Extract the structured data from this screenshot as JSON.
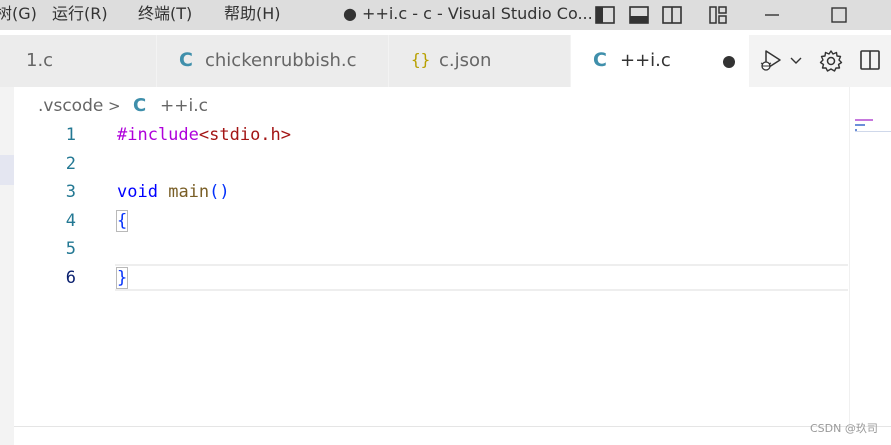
{
  "menubar": {
    "items": [
      "树(G)",
      "运行(R)",
      "终端(T)",
      "帮助(H)"
    ]
  },
  "window_title": "● ++i.c - c - Visual Studio Co...",
  "title_icons": [
    "toggle-primary-sidebar-icon",
    "toggle-panel-icon",
    "toggle-secondary-sidebar-icon",
    "customize-layout-icon",
    "minimize-icon",
    "maximize-icon"
  ],
  "tabs": [
    {
      "label": "1.c",
      "icon": "",
      "active": false
    },
    {
      "label": "chickenrubbish.c",
      "icon": "C",
      "active": false
    },
    {
      "label": "c.json",
      "icon": "{}",
      "active": false
    },
    {
      "label": "++i.c",
      "icon": "C",
      "active": true,
      "dirty": true
    }
  ],
  "tab_actions": [
    "run-debug-icon",
    "chevron-down-icon",
    "gear-icon",
    "split-editor-icon"
  ],
  "breadcrumb": {
    "folder": ".vscode",
    "separator": ">",
    "file_icon": "C",
    "file": "++i.c"
  },
  "editor": {
    "line_numbers": [
      "1",
      "2",
      "3",
      "4",
      "5",
      "6"
    ],
    "current_line": "6",
    "lines": [
      {
        "tokens": [
          {
            "t": "#include",
            "c": "pp"
          },
          {
            "t": "<stdio.h>",
            "c": "str"
          }
        ]
      },
      {
        "tokens": []
      },
      {
        "tokens": [
          {
            "t": "void",
            "c": "kw"
          },
          {
            "t": " ",
            "c": ""
          },
          {
            "t": "main",
            "c": "fn"
          },
          {
            "t": "()",
            "c": "punc"
          }
        ]
      },
      {
        "tokens": [
          {
            "t": "{",
            "c": "punc"
          }
        ]
      },
      {
        "tokens": []
      },
      {
        "tokens": [
          {
            "t": "}",
            "c": "punc"
          }
        ]
      }
    ]
  },
  "watermark": "CSDN @玖司",
  "colors": {
    "accent_c_icon": "#3f8fab",
    "json_icon": "#b8a000",
    "keyword": "#0000ff",
    "function": "#795e26",
    "preprocessor": "#af00db",
    "include_string": "#a31515",
    "line_number": "#237893"
  }
}
